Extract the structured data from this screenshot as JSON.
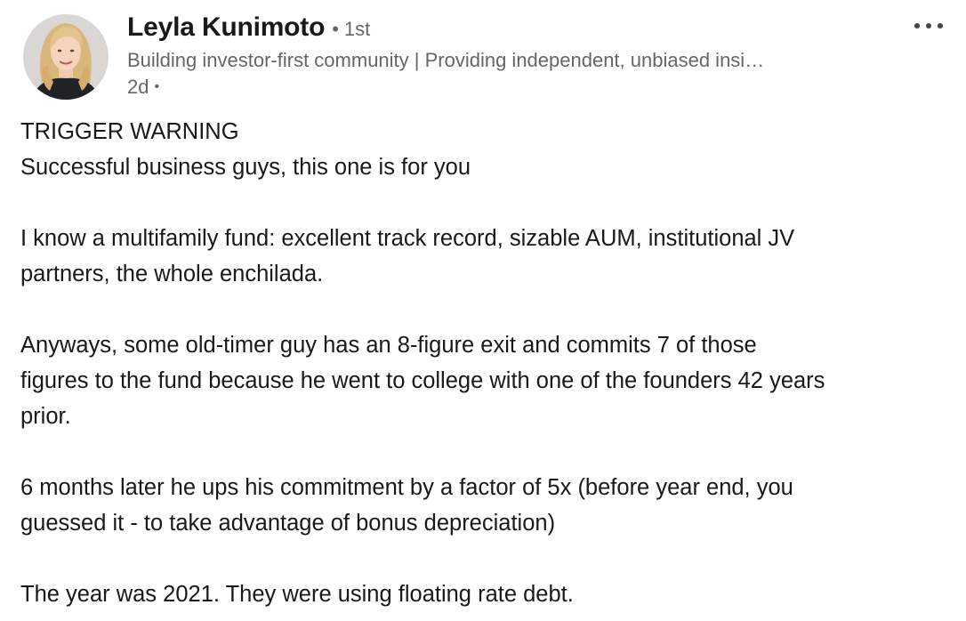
{
  "author": {
    "name": "Leyla Kunimoto",
    "degree_separator": "•",
    "degree": "1st",
    "headline": "Building investor-first community | Providing independent, unbiased insi…",
    "time_ago": "2d",
    "time_separator": "•"
  },
  "menu": {
    "icon": "more-horizontal-icon"
  },
  "post": {
    "lines": [
      "TRIGGER WARNING",
      "Successful business guys, this one is for you",
      "",
      "I know a multifamily fund: excellent track record, sizable AUM, institutional JV",
      "partners, the whole enchilada.",
      "",
      "Anyways, some old-timer guy has an 8-figure exit and commits 7 of those",
      "figures to the fund because he went to college with one of the founders 42 years",
      "prior.",
      "",
      "6 months later he ups his commitment by a factor of 5x (before year end, you",
      "guessed it - to take advantage of bonus depreciation)",
      "",
      "The year was 2021. They were using floating rate debt."
    ]
  },
  "colors": {
    "text_primary": "#191919",
    "text_secondary": "#666666",
    "background": "#ffffff"
  }
}
